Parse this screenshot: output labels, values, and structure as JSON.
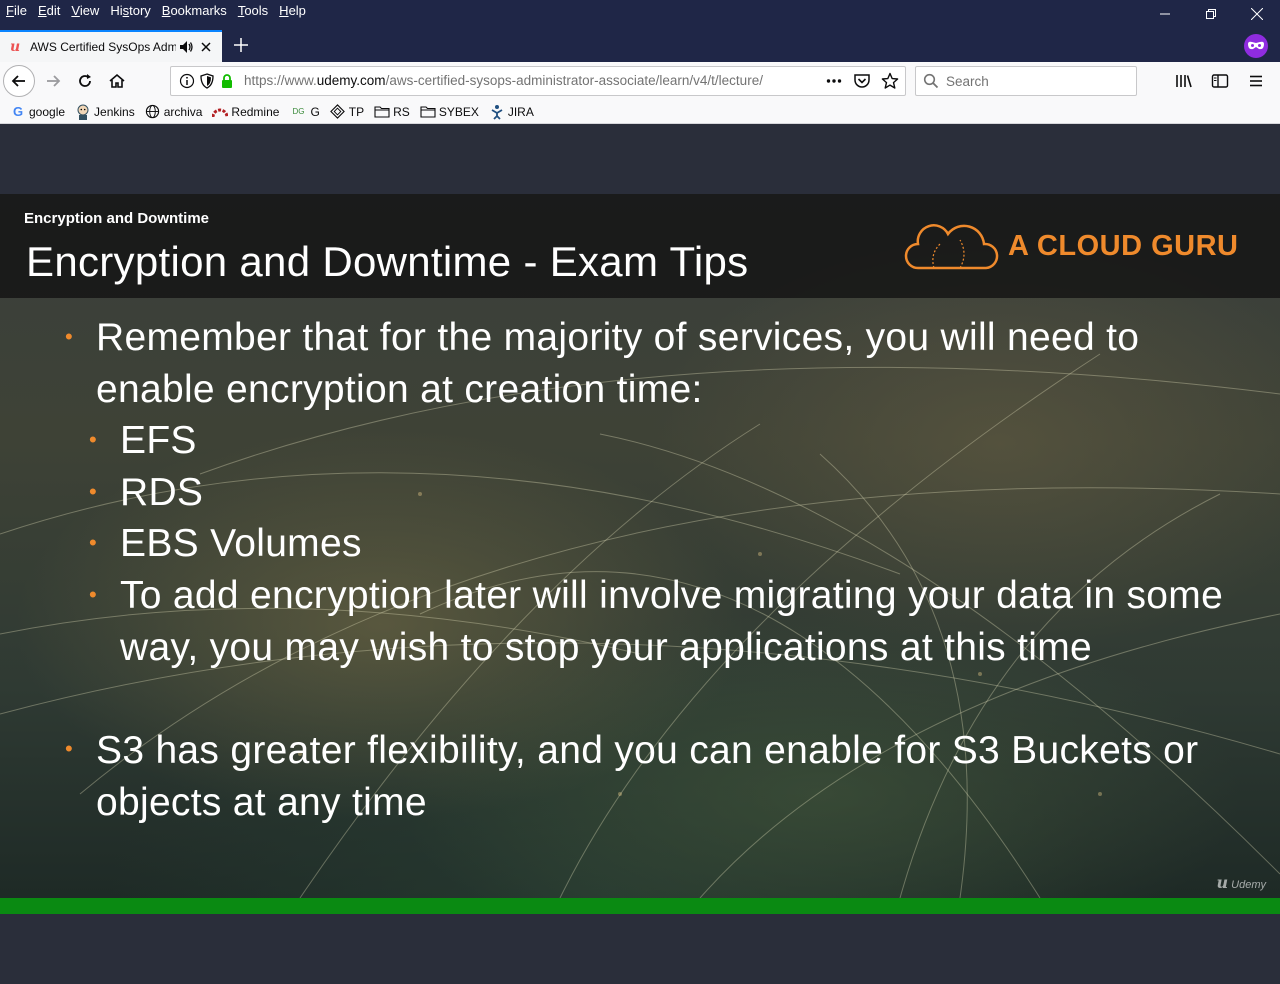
{
  "menu": {
    "items": [
      "File",
      "Edit",
      "View",
      "History",
      "Bookmarks",
      "Tools",
      "Help"
    ],
    "accelerators": [
      "F",
      "E",
      "V",
      "s",
      "B",
      "T",
      "H"
    ]
  },
  "tab": {
    "title": "AWS Certified SysOps Admi",
    "favicon": "udemy-icon"
  },
  "url": {
    "prefix": "https://www.",
    "domain": "udemy.com",
    "path": "/aws-certified-sysops-administrator-associate/learn/v4/t/lecture/"
  },
  "search": {
    "placeholder": "Search",
    "value": ""
  },
  "bookmarks": [
    {
      "label": "google",
      "icon": "google-icon"
    },
    {
      "label": "Jenkins",
      "icon": "jenkins-icon"
    },
    {
      "label": "archiva",
      "icon": "globe-icon"
    },
    {
      "label": "Redmine",
      "icon": "redmine-icon"
    },
    {
      "label": "G",
      "icon": "dg-icon"
    },
    {
      "label": "TP",
      "icon": "tp-icon"
    },
    {
      "label": "RS",
      "icon": "folder-icon"
    },
    {
      "label": "SYBEX",
      "icon": "folder-icon"
    },
    {
      "label": "JIRA",
      "icon": "jira-icon"
    }
  ],
  "slide": {
    "kicker": "Encryption and Downtime",
    "title": "Encryption and Downtime - Exam Tips",
    "brand": "A CLOUD GURU",
    "bullets": {
      "b1_line1": "Remember that for the majority of services, you will need to",
      "b1_line2": "enable encryption at creation time:",
      "sub1": "EFS",
      "sub2": "RDS",
      "sub3": "EBS Volumes",
      "sub4_line1": "To add encryption later will involve migrating your data in some",
      "sub4_line2": "way, you may wish to stop your applications at this time",
      "b2_line1": "S3 has greater flexibility, and you can enable for S3 Buckets or",
      "b2_line2": "objects at any time"
    },
    "watermark": "Udemy"
  },
  "progress": {
    "fraction": 1.0
  },
  "colors": {
    "titlebar": "#1f2647",
    "accent_orange": "#ef8a2c",
    "progress_green": "#0a8a12",
    "page_bg": "#2a2e3a"
  }
}
